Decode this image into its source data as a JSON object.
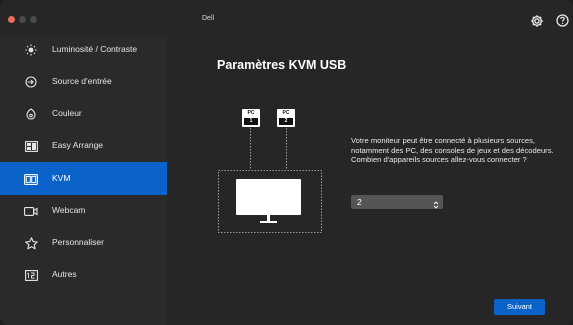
{
  "app": {
    "title": "Dell"
  },
  "header": {
    "settings_icon": "gear-icon",
    "help_icon": "help-icon"
  },
  "sidebar": {
    "items": [
      {
        "label": "Luminosité / Contraste",
        "icon": "brightness-icon",
        "active": false
      },
      {
        "label": "Source d'entrée",
        "icon": "input-source-icon",
        "active": false
      },
      {
        "label": "Couleur",
        "icon": "color-icon",
        "active": false
      },
      {
        "label": "Easy Arrange",
        "icon": "easy-arrange-icon",
        "active": false
      },
      {
        "label": "KVM",
        "icon": "kvm-icon",
        "active": true
      },
      {
        "label": "Webcam",
        "icon": "webcam-icon",
        "active": false
      },
      {
        "label": "Personnaliser",
        "icon": "star-icon",
        "active": false
      },
      {
        "label": "Autres",
        "icon": "others-icon",
        "active": false
      }
    ]
  },
  "main": {
    "title": "Paramètres KVM USB",
    "diagram": {
      "pcs": [
        {
          "label": "PC",
          "number": "1"
        },
        {
          "label": "PC",
          "number": "2"
        }
      ]
    },
    "description": "Votre moniteur peut être connecté à plusieurs sources, notamment des PC, des consoles de jeux et des décodeurs. Combien d'appareils sources allez-vous connecter ?",
    "select": {
      "value": "2"
    },
    "next_button": "Suivant"
  },
  "colors": {
    "accent": "#0b63c9",
    "background": "#262626",
    "sidebar": "#2a2a2a"
  }
}
